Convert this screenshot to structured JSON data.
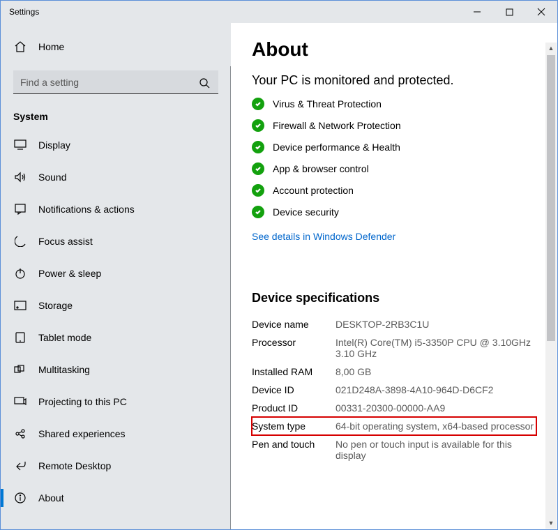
{
  "window": {
    "title": "Settings"
  },
  "sidebar": {
    "home": "Home",
    "search_placeholder": "Find a setting",
    "category": "System",
    "items": [
      {
        "label": "Display"
      },
      {
        "label": "Sound"
      },
      {
        "label": "Notifications & actions"
      },
      {
        "label": "Focus assist"
      },
      {
        "label": "Power & sleep"
      },
      {
        "label": "Storage"
      },
      {
        "label": "Tablet mode"
      },
      {
        "label": "Multitasking"
      },
      {
        "label": "Projecting to this PC"
      },
      {
        "label": "Shared experiences"
      },
      {
        "label": "Remote Desktop"
      },
      {
        "label": "About"
      }
    ]
  },
  "main": {
    "title": "About",
    "protection_heading": "Your PC is monitored and protected.",
    "protection_items": [
      "Virus & Threat Protection",
      "Firewall & Network Protection",
      "Device performance & Health",
      "App & browser control",
      "Account protection",
      "Device security"
    ],
    "defender_link": "See details in Windows Defender",
    "specs_heading": "Device specifications",
    "specs": {
      "device_name_k": "Device name",
      "device_name_v": "DESKTOP-2RB3C1U",
      "processor_k": "Processor",
      "processor_v": "Intel(R) Core(TM) i5-3350P CPU @ 3.10GHz 3.10 GHz",
      "ram_k": "Installed RAM",
      "ram_v": "8,00 GB",
      "device_id_k": "Device ID",
      "device_id_v": "021D248A-3898-4A10-964D-D6CF2",
      "product_id_k": "Product ID",
      "product_id_v": "00331-20300-00000-AA9",
      "system_type_k": "System type",
      "system_type_v": "64-bit operating system, x64-based processor",
      "pen_touch_k": "Pen and touch",
      "pen_touch_v": "No pen or touch input is available for this display"
    }
  }
}
